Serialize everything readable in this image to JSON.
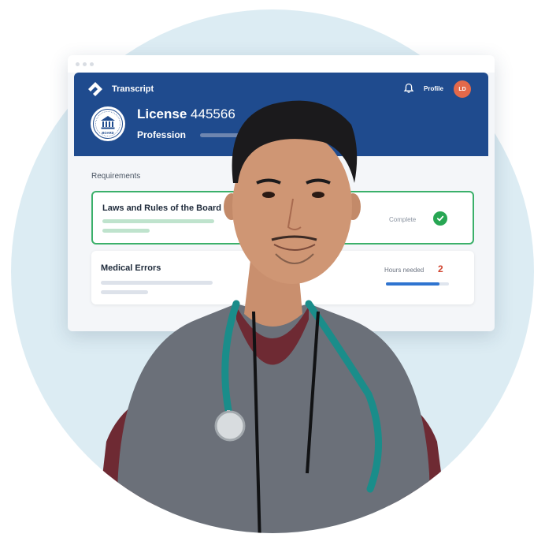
{
  "app": {
    "brand": "Transcript",
    "profile_label": "Profile",
    "avatar_initials": "LD"
  },
  "license": {
    "label": "License",
    "number": "445566",
    "profession_label": "Profession",
    "seal_text": "BOARD"
  },
  "requirements": {
    "heading": "Requirements",
    "items": [
      {
        "title": "Laws and Rules of the Board",
        "status": "Complete",
        "state": "complete"
      },
      {
        "title": "Medical Errors",
        "status": "Hours needed",
        "hours": "2",
        "progress": 0.85
      }
    ]
  },
  "colors": {
    "header": "#1f4b8e",
    "complete": "#27a653",
    "accent": "#2f74d0",
    "avatar": "#e4694a",
    "background_circle": "#dcecf3"
  }
}
